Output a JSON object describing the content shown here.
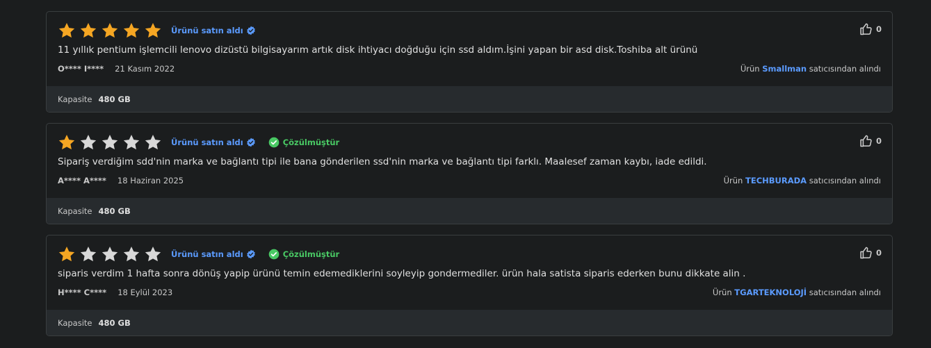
{
  "colors": {
    "star_filled": "#f5a623",
    "star_empty": "#d8d8d8",
    "link_blue": "#5b9bff",
    "resolved_green": "#49c964"
  },
  "reviews": [
    {
      "rating": 5,
      "purchased_label": "Ürünü satın aldı",
      "resolved_label": "",
      "likes": "0",
      "comment": "11 yıllık pentium işlemcili lenovo dizüstü bilgisayarım artık disk ihtiyacı doğduğu için ssd aldım.İşini yapan bir asd disk.Toshiba alt ürünü",
      "author": "O**** I****",
      "date": "21 Kasım 2022",
      "seller_prefix": "Ürün",
      "seller_name": "Smallman",
      "seller_suffix": "satıcısından alındı",
      "attr_label": "Kapasite",
      "attr_value": "480 GB"
    },
    {
      "rating": 1,
      "purchased_label": "Ürünü satın aldı",
      "resolved_label": "Çözülmüştür",
      "likes": "0",
      "comment": "Sipariş verdiğim sdd'nin marka ve bağlantı tipi ile bana gönderilen ssd'nin marka ve bağlantı tipi farklı. Maalesef zaman kaybı, iade edildi.",
      "author": "A**** A****",
      "date": "18 Haziran 2025",
      "seller_prefix": "Ürün",
      "seller_name": "TECHBURADA",
      "seller_suffix": "satıcısından alındı",
      "attr_label": "Kapasite",
      "attr_value": "480 GB"
    },
    {
      "rating": 1,
      "purchased_label": "Ürünü satın aldı",
      "resolved_label": "Çözülmüştür",
      "likes": "0",
      "comment": "siparis verdim 1 hafta sonra dönüş yapip ürünü temin edemediklerini soyleyip gondermediler. ürün hala satista siparis ederken bunu dikkate alin .",
      "author": "H**** C****",
      "date": "18 Eylül 2023",
      "seller_prefix": "Ürün",
      "seller_name": "TGARTEKNOLOJİ",
      "seller_suffix": "satıcısından alındı",
      "attr_label": "Kapasite",
      "attr_value": "480 GB"
    }
  ]
}
